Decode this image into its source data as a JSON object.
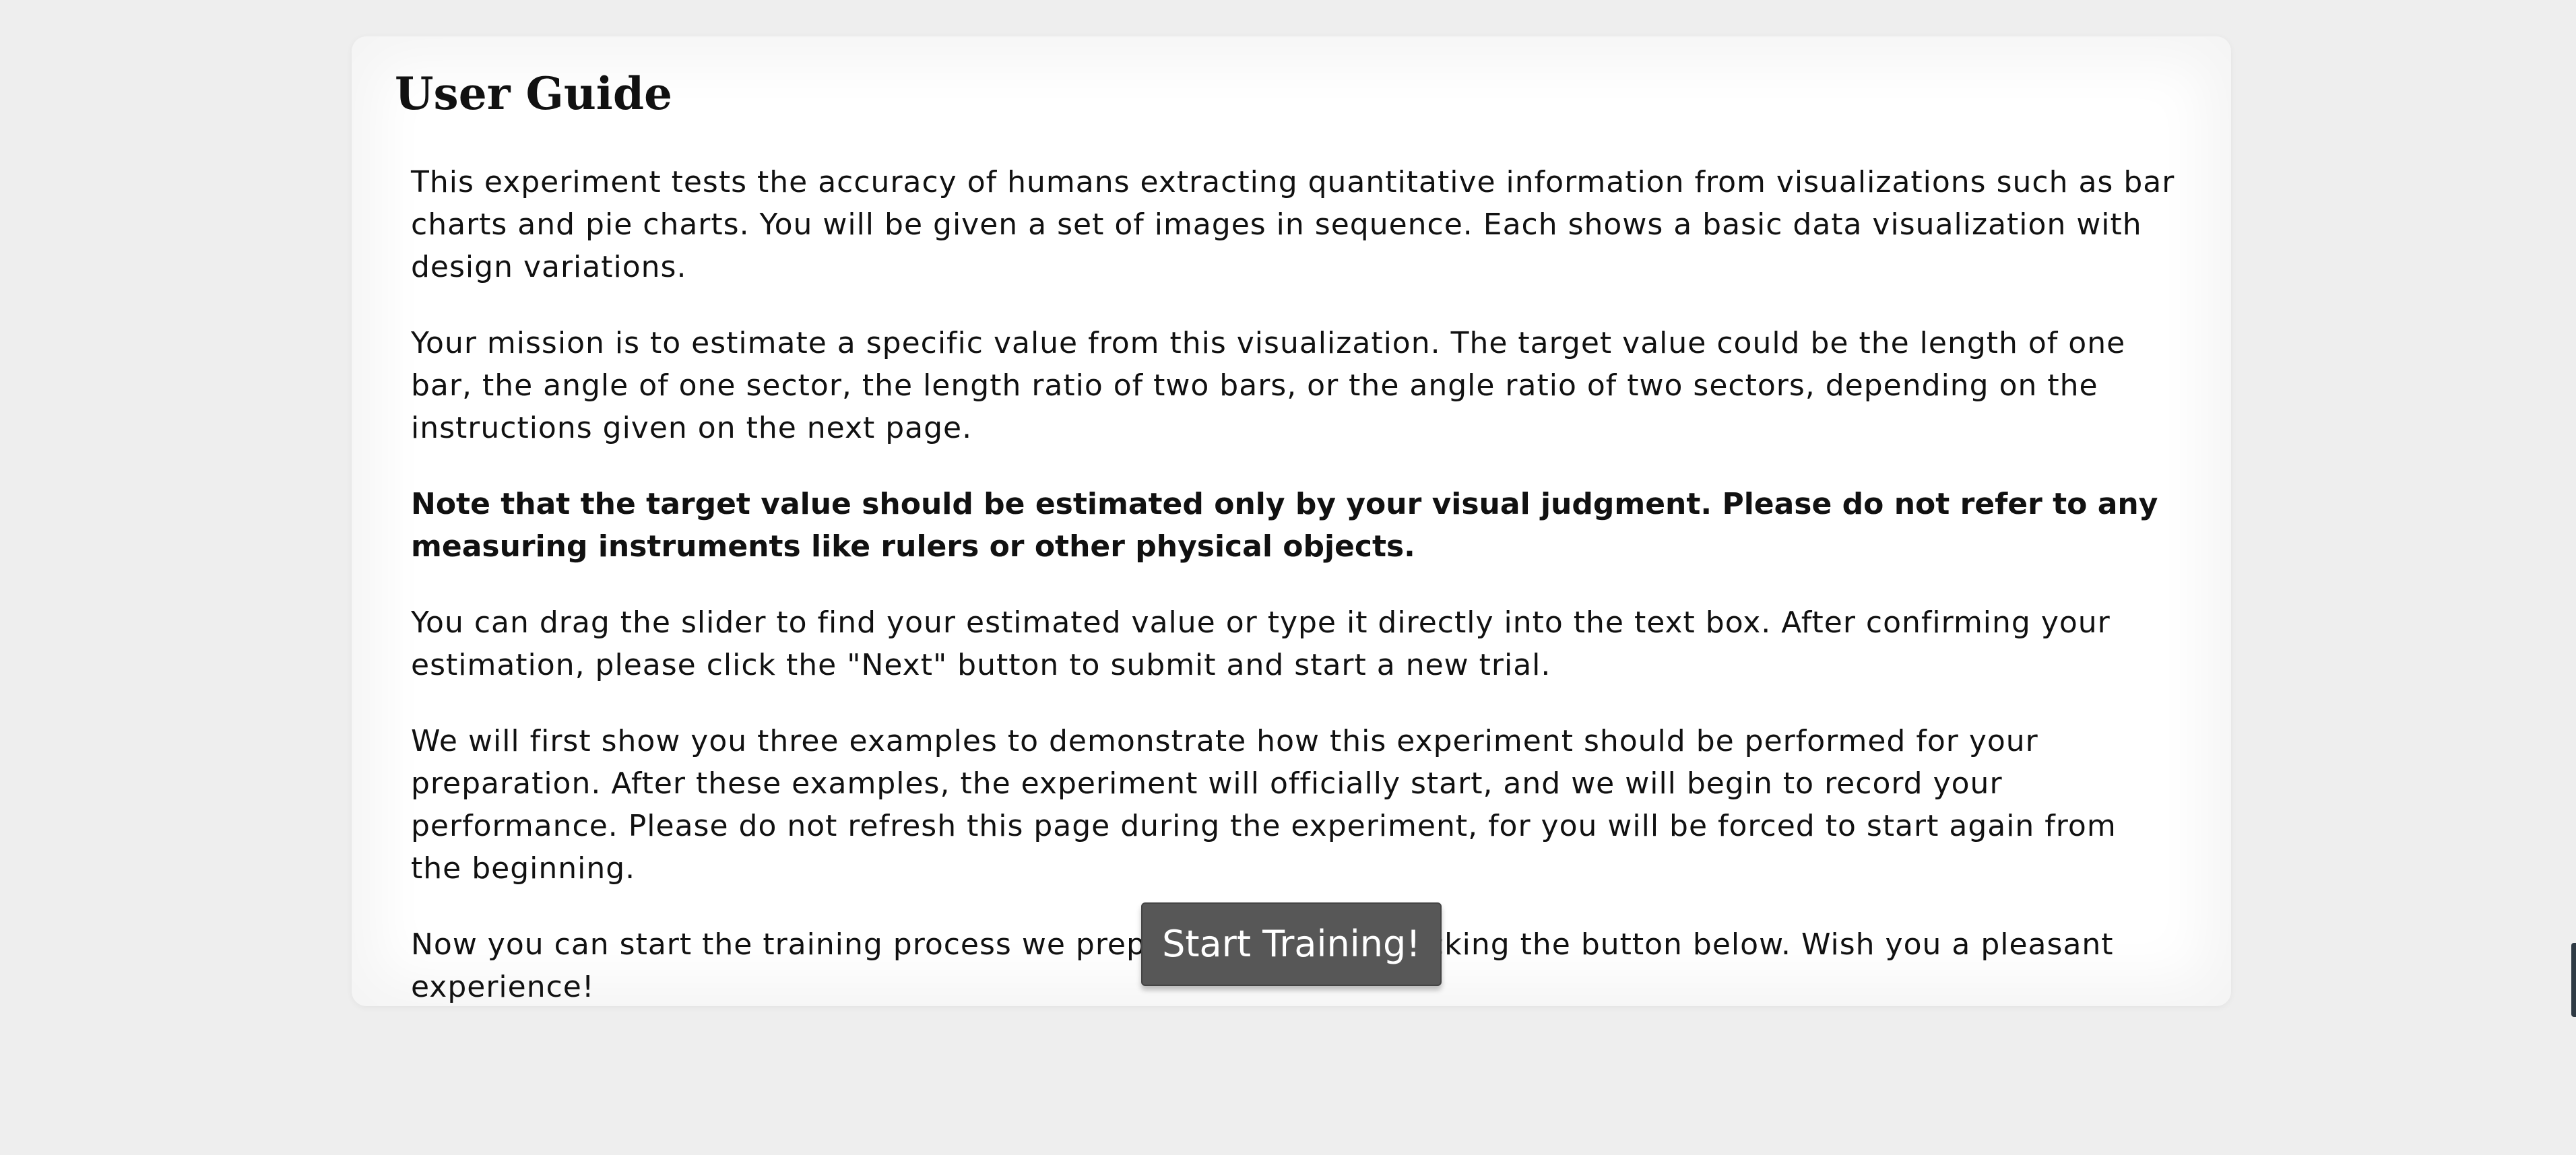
{
  "guide": {
    "title": "User Guide",
    "paragraphs": [
      "This experiment tests the accuracy of humans extracting quantitative information from visualizations such as bar charts and pie charts. You will be given a set of images in sequence. Each shows a basic data visualization with design variations.",
      "Your mission is to estimate a specific value from this visualization. The target value could be the length of one bar, the angle of one sector, the length ratio of two bars, or the angle ratio of two sectors, depending on the instructions given on the next page.",
      "Note that the target value should be estimated only by your visual judgment. Please do not refer to any measuring instruments like rulers or other physical objects.",
      "You can drag the slider to find your estimated value or type it directly into the text box. After confirming your estimation, please click the \"Next\" button to submit and start a new trial.",
      "We will first show you three examples to demonstrate how this experiment should be performed for your preparation. After these examples, the experiment will officially start, and we will begin to record your performance. Please do not refresh this page during the experiment, for you will be forced to start again from the beginning.",
      "Now you can start the training process we prepared for you by clicking the button below. Wish you a pleasant experience!"
    ],
    "start_button_label": "Start Training!"
  }
}
